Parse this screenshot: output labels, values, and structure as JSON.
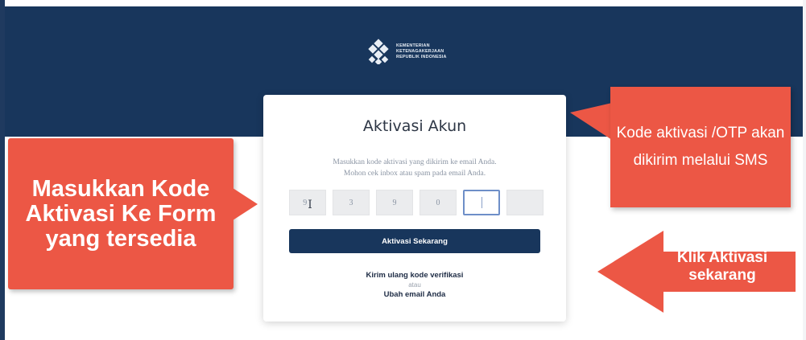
{
  "header": {
    "logo_lines": [
      "KEMENTERIAN",
      "KETENAGAKERJAAN",
      "REPUBLIK INDONESIA"
    ],
    "background_color": "#18365c"
  },
  "card": {
    "title": "Aktivasi Akun",
    "instruction_line1": "Masukkan kode aktivasi yang dikirim ke email Anda.",
    "instruction_line2": "Mohon cek inbox atau spam pada email Anda.",
    "otp_digits": [
      "9",
      "3",
      "9",
      "0",
      "",
      ""
    ],
    "submit_label": "Aktivasi Sekarang",
    "resend_label": "Kirim ulang kode verifikasi",
    "or_label": "atau",
    "change_email_label": "Ubah email Anda"
  },
  "annotations": {
    "left": "Masukkan Kode Aktivasi Ke Form yang tersedia",
    "top_right": "Kode aktivasi /OTP akan dikirim melalui SMS",
    "bottom_right": "Klik Aktivasi sekarang",
    "color": "#ec5745"
  }
}
